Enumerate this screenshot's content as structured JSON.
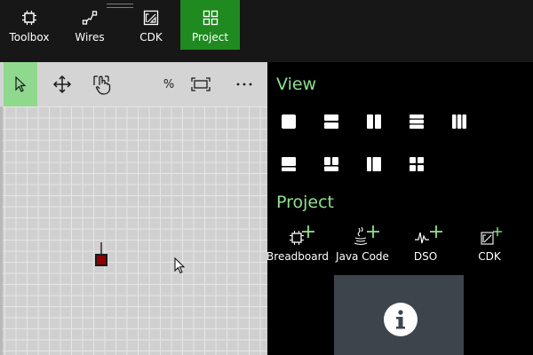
{
  "toolbar": {
    "toolbox_label": "Toolbox",
    "wires_label": "Wires",
    "cdk_label": "CDK",
    "project_label": "Project",
    "active_tab": "Project",
    "active_color": "#1f8a1f"
  },
  "canvas_toolbar": {
    "percent_label": "%",
    "more_label": "···",
    "select_active_color": "#8fd98f"
  },
  "right_panel": {
    "view_title": "View",
    "project_title": "Project",
    "accent_color": "#8fe08f",
    "add_buttons": [
      {
        "label": "Breadboard",
        "icon": "breadboard-add-icon"
      },
      {
        "label": "Java Code",
        "icon": "java-add-icon"
      },
      {
        "label": "DSO",
        "icon": "dso-add-icon"
      },
      {
        "label": "CDK",
        "icon": "cdk-add-icon"
      }
    ]
  }
}
